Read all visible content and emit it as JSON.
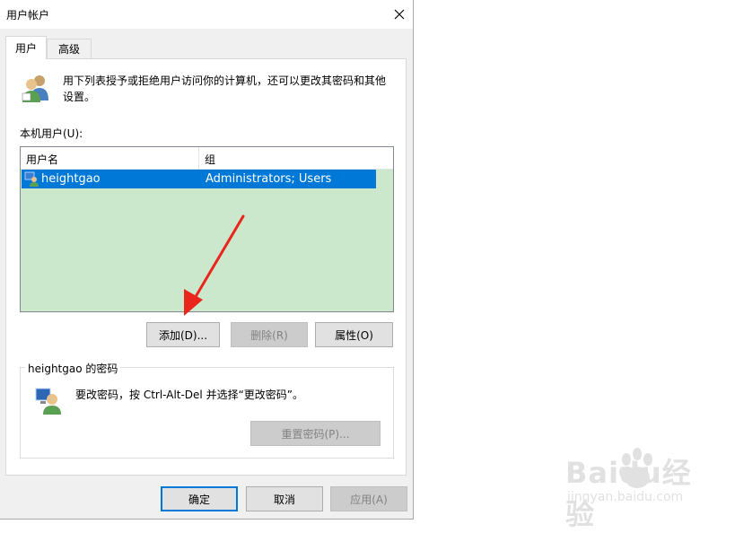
{
  "window": {
    "title": "用户帐户"
  },
  "tabs": [
    {
      "label": "用户"
    },
    {
      "label": "高级"
    }
  ],
  "info_text": "用下列表授予或拒绝用户访问你的计算机，还可以更改其密码和其他设置。",
  "local_users_label": "本机用户(U):",
  "table": {
    "columns": [
      "用户名",
      "组"
    ],
    "rows": [
      {
        "name": "heightgao",
        "group": "Administrators; Users",
        "selected": true
      }
    ]
  },
  "buttons": {
    "add": "添加(D)...",
    "remove": "删除(R)",
    "properties": "属性(O)"
  },
  "password_group": {
    "title": "heightgao 的密码",
    "text": "要改密码，按 Ctrl-Alt-Del 并选择“更改密码”。",
    "reset_button": "重置密码(P)..."
  },
  "dialog_buttons": {
    "ok": "确定",
    "cancel": "取消",
    "apply": "应用(A)"
  },
  "watermark": {
    "logo": "Baidu经验",
    "url": "jingyan.baidu.com"
  },
  "colors": {
    "selection": "#0078d7",
    "list_background": "#cbe8cd",
    "annotation_arrow": "#e8261c"
  }
}
